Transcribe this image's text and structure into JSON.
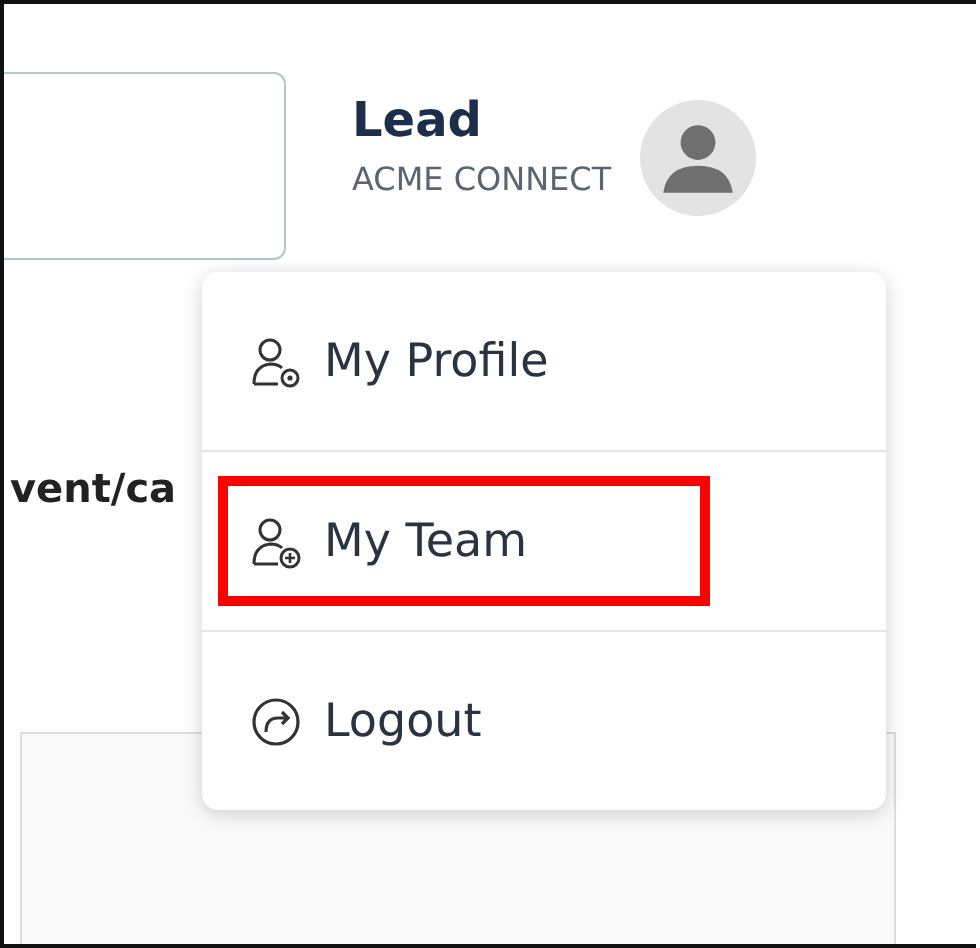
{
  "header": {
    "user_name": "Lead",
    "organization": "ACME CONNECT"
  },
  "content": {
    "path_text": "vent/ca"
  },
  "user_menu": {
    "items": [
      {
        "kind": "profile",
        "label": "My Profile",
        "highlighted": false
      },
      {
        "kind": "team",
        "label": "My Team",
        "highlighted": true
      },
      {
        "kind": "logout",
        "label": "Logout",
        "highlighted": false
      }
    ]
  }
}
